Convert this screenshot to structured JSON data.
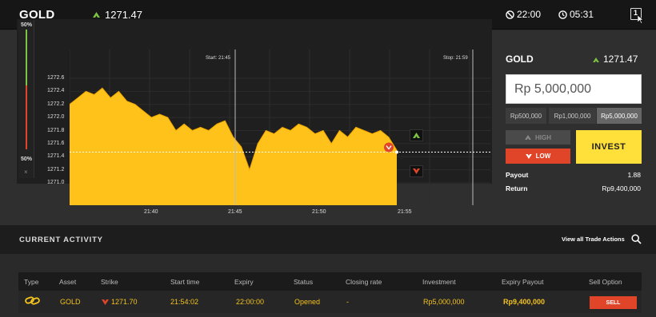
{
  "header": {
    "asset": "GOLD",
    "price": "1271.47",
    "expiry_time": "22:00",
    "countdown": "05:31"
  },
  "gauge": {
    "top_pct": "50%",
    "bottom_pct": "50%",
    "close_glyph": "×"
  },
  "chart_markers": {
    "start": "Start: 21:45",
    "stop": "Stop: 21:59"
  },
  "chart_data": {
    "type": "area",
    "yticks": [
      "1272.6",
      "1272.4",
      "1272.2",
      "1272.0",
      "1271.8",
      "1271.6",
      "1271.4",
      "1271.2",
      "1271.0"
    ],
    "xticks": [
      "21:40",
      "21:45",
      "21:50",
      "21:55"
    ],
    "ylim": [
      1270.8,
      1272.8
    ],
    "current_value": 1271.47,
    "color": "#ffc21a",
    "x": [
      0,
      1,
      2,
      3,
      4,
      5,
      6,
      7,
      8,
      9,
      10,
      11,
      12,
      13,
      14,
      15,
      16,
      17,
      18,
      19,
      20,
      21,
      22,
      23,
      24,
      25,
      26,
      27,
      28,
      29,
      30,
      31,
      32,
      33,
      34,
      35,
      36,
      37,
      38,
      39,
      40
    ],
    "values": [
      1272.2,
      1272.3,
      1272.4,
      1272.35,
      1272.45,
      1272.3,
      1272.4,
      1272.25,
      1272.2,
      1272.1,
      1272.0,
      1272.05,
      1272.0,
      1271.8,
      1271.9,
      1271.8,
      1271.85,
      1271.8,
      1271.9,
      1271.95,
      1271.7,
      1271.55,
      1271.2,
      1271.6,
      1271.8,
      1271.75,
      1271.85,
      1271.8,
      1271.9,
      1271.85,
      1271.75,
      1271.8,
      1271.6,
      1271.8,
      1271.7,
      1271.85,
      1271.8,
      1271.75,
      1271.8,
      1271.7,
      1271.5
    ]
  },
  "trade_panel": {
    "asset": "GOLD",
    "price": "1271.47",
    "amount": "Rp 5,000,000",
    "presets": [
      "Rp500,000",
      "Rp1,000,000",
      "Rp5,000,000"
    ],
    "high_label": "HIGH",
    "low_label": "LOW",
    "invest_label": "INVEST",
    "payout_label": "Payout",
    "payout_value": "1.88",
    "return_label": "Return",
    "return_value": "Rp9,400,000"
  },
  "activity": {
    "title": "CURRENT ACTIVITY",
    "view_all": "View all Trade Actions",
    "columns": [
      "Type",
      "Asset",
      "Strike",
      "Start time",
      "Expiry",
      "Status",
      "Closing rate",
      "Investment",
      "Expiry Payout",
      "Sell Option"
    ],
    "row": {
      "asset": "GOLD",
      "strike": "1271.70",
      "start_time": "21:54:02",
      "expiry": "22:00:00",
      "status": "Opened",
      "closing_rate": "-",
      "investment": "Rp5,000,000",
      "expiry_payout": "Rp9,400,000",
      "sell_label": "SELL"
    }
  },
  "colors": {
    "accent_yellow": "#ffc21a",
    "invest_yellow": "#ffe03a",
    "down_red": "#e0452a",
    "up_green": "#7cc243"
  }
}
